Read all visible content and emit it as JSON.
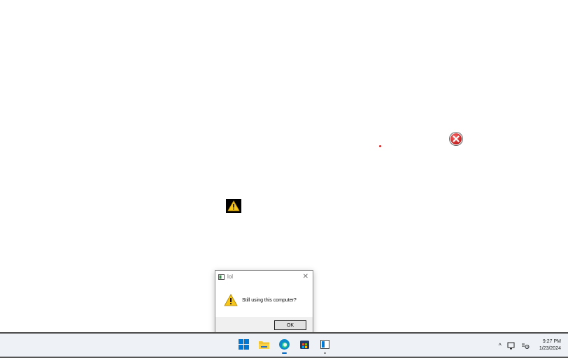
{
  "desktop": {
    "error_icon": "error-x-icon",
    "warning_icon": "warning-icon"
  },
  "dialog": {
    "title": "lol",
    "message": "Still using this computer?",
    "ok_label": "OK",
    "close_icon": "close-icon",
    "message_icon": "warning-icon"
  },
  "taskbar": {
    "apps": [
      "start-icon",
      "file-explorer-icon",
      "edge-icon",
      "store-icon",
      "app-window-icon"
    ],
    "tray": {
      "chevron_icon": "chevron-up-icon",
      "network_icon": "network-icon",
      "settings_icon": "display-settings-icon",
      "time": "9:27 PM",
      "date": "1/23/2024"
    }
  },
  "colors": {
    "accent": "#0067c0",
    "error_red": "#e02020",
    "warning_yellow": "#f5c518"
  }
}
